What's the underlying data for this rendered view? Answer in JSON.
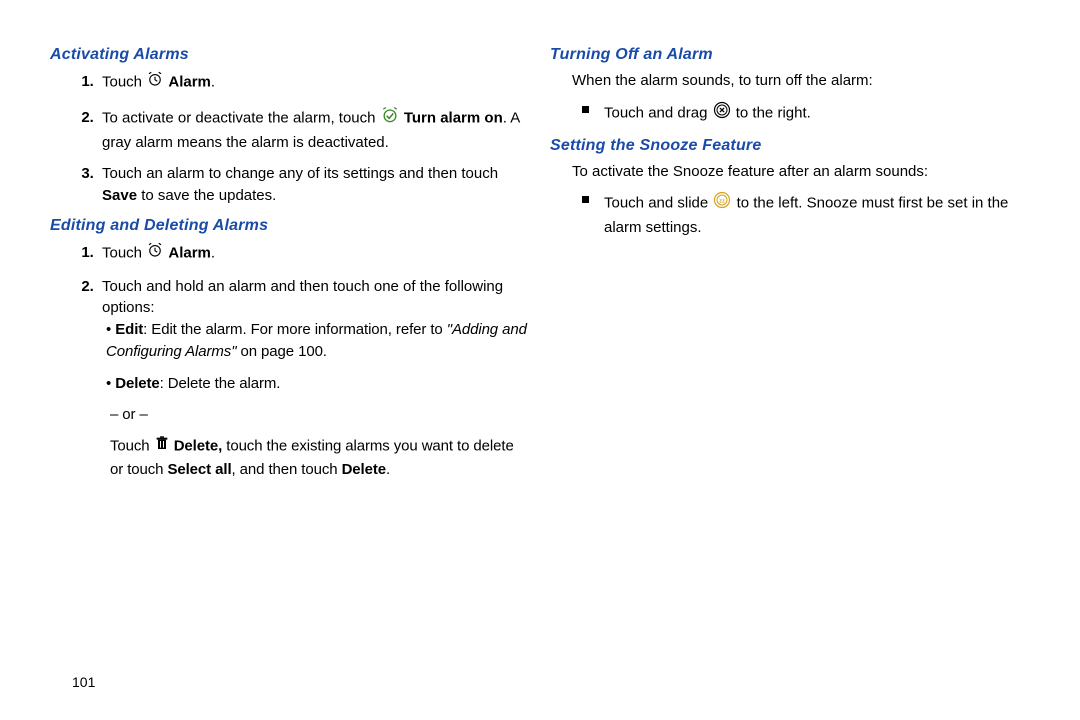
{
  "page_number": "101",
  "left": {
    "h1": "Activating Alarms",
    "s1_step1_a": "Touch ",
    "s1_step1_b": "Alarm",
    "s1_step1_c": ".",
    "s1_step2_a": "To activate or deactivate the alarm, touch ",
    "s1_step2_b": "Turn alarm on",
    "s1_step2_c": ". A gray alarm means the alarm is deactivated.",
    "s1_step3_a": "Touch an alarm to change any of its settings and then touch ",
    "s1_step3_b": "Save",
    "s1_step3_c": " to save the updates.",
    "h2": "Editing and Deleting Alarms",
    "s2_step1_a": "Touch ",
    "s2_step1_b": "Alarm",
    "s2_step1_c": ".",
    "s2_step2": "Touch and hold an alarm and then touch one of the following options:",
    "s2_sub1_a": "Edit",
    "s2_sub1_b": ": Edit the alarm. For more information, refer to ",
    "s2_sub1_c": "\"Adding and Configuring Alarms\"",
    "s2_sub1_d": " on page 100.",
    "s2_sub2_a": "Delete",
    "s2_sub2_b": ": Delete the alarm.",
    "or": "– or –",
    "after_a": "Touch ",
    "after_b": "Delete,",
    "after_c": " touch the existing alarms you want to delete or touch ",
    "after_d": "Select all",
    "after_e": ", and then touch ",
    "after_f": "Delete",
    "after_g": "."
  },
  "right": {
    "h1": "Turning Off an Alarm",
    "intro1": "When the alarm sounds, to turn off the alarm:",
    "b1_a": "Touch and drag ",
    "b1_b": " to the right.",
    "h2": "Setting the Snooze Feature",
    "intro2": "To activate the Snooze feature after an alarm sounds:",
    "b2_a": "Touch and slide ",
    "b2_b": " to the left. Snooze must first be set in the alarm settings."
  }
}
